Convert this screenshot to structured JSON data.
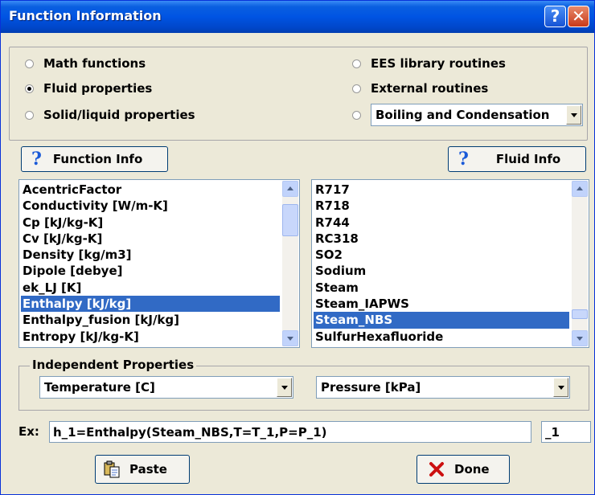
{
  "window": {
    "title": "Function Information",
    "help_glyph": "?",
    "close_glyph": "✕"
  },
  "categories": {
    "math_functions": "Math functions",
    "fluid_properties": "Fluid properties",
    "solid_liquid_properties": "Solid/liquid properties",
    "ees_library_routines": "EES library routines",
    "external_routines": "External routines",
    "selected": "Fluid properties",
    "library_combo_value": "Boiling and Condensation"
  },
  "function_info_button": {
    "icon": "question-icon",
    "glyph": "?",
    "label": "Function Info"
  },
  "fluid_info_button": {
    "icon": "question-icon",
    "glyph": "?",
    "label": "Fluid Info"
  },
  "functions_list": {
    "items": [
      "AcentricFactor",
      "Conductivity [W/m-K]",
      "Cp [kJ/kg-K]",
      "Cv [kJ/kg-K]",
      "Density [kg/m3]",
      "Dipole [debye]",
      "ek_LJ [K]",
      "Enthalpy [kJ/kg]",
      "Enthalpy_fusion [kJ/kg]",
      "Entropy [kJ/kg-K]"
    ],
    "selected": "Enthalpy [kJ/kg]"
  },
  "fluids_list": {
    "items": [
      "R717",
      "R718",
      "R744",
      "RC318",
      "SO2",
      "Sodium",
      "Steam",
      "Steam_IAPWS",
      "Steam_NBS",
      "SulfurHexafluoride"
    ],
    "selected": "Steam_NBS"
  },
  "independent_properties": {
    "label": "Independent Properties",
    "first": "Temperature [C]",
    "second": "Pressure [kPa]"
  },
  "example": {
    "label": "Ex:",
    "value": "h_1=Enthalpy(Steam_NBS,T=T_1,P=P_1)",
    "suffix": "_1"
  },
  "paste_button": {
    "icon": "paste-icon",
    "label": "Paste"
  },
  "done_button": {
    "icon": "x-icon",
    "label": "Done"
  },
  "colors": {
    "title_bar": "#0054e3",
    "selection": "#316ac5",
    "dialog_bg": "#ece9d8",
    "done_x": "#cc1010"
  }
}
